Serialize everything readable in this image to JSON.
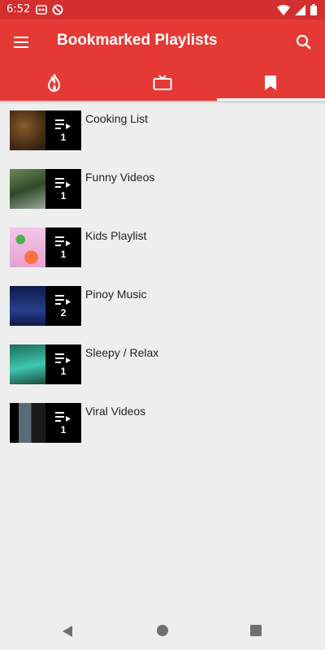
{
  "status_bar": {
    "time": "6:52",
    "icons_left": [
      "notification-icon",
      "sync-off-icon"
    ],
    "icons_right": [
      "wifi-icon",
      "signal-icon",
      "battery-icon"
    ]
  },
  "app_bar": {
    "title": "Bookmarked Playlists",
    "menu_icon": "hamburger-menu-icon",
    "search_icon": "search-icon",
    "color": "#e53935"
  },
  "tabs": [
    {
      "icon": "fire-icon",
      "active": false
    },
    {
      "icon": "tv-icon",
      "active": false
    },
    {
      "icon": "bookmark-icon",
      "active": true
    }
  ],
  "playlists": [
    {
      "title": "Cooking List",
      "count": "1",
      "thumb_color": "#5b3a22"
    },
    {
      "title": "Funny Videos",
      "count": "1",
      "thumb_color": "#3f5a36"
    },
    {
      "title": "Kids Playlist",
      "count": "1",
      "thumb_color": "#e9a3d4"
    },
    {
      "title": "Pinoy Music",
      "count": "2",
      "thumb_color": "#1a2a6c"
    },
    {
      "title": "Sleepy / Relax",
      "count": "1",
      "thumb_color": "#2b8c7d"
    },
    {
      "title": "Viral Videos",
      "count": "1",
      "thumb_color": "#4a5560"
    }
  ],
  "nav_bar": {
    "back_icon": "back-triangle-icon",
    "home_icon": "home-circle-icon",
    "recents_icon": "recents-square-icon"
  }
}
